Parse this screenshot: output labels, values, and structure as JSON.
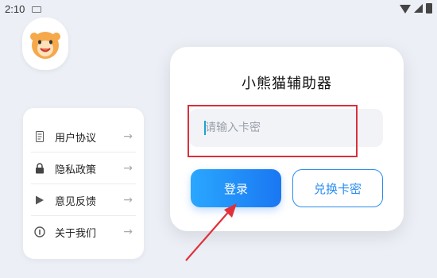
{
  "status_bar": {
    "time": "2:10"
  },
  "app": {
    "title": "小熊猫辅助器"
  },
  "key_input": {
    "placeholder": "请输入卡密",
    "value": ""
  },
  "buttons": {
    "login": "登录",
    "redeem": "兑换卡密"
  },
  "menu": {
    "items": [
      {
        "label": "用户协议",
        "icon": "document-icon"
      },
      {
        "label": "隐私政策",
        "icon": "lock-icon"
      },
      {
        "label": "意见反馈",
        "icon": "play-icon"
      },
      {
        "label": "关于我们",
        "icon": "info-icon"
      }
    ]
  },
  "colors": {
    "accent": "#2b8ef0",
    "highlight": "#d9303a",
    "avatar": "#f5a94a"
  }
}
